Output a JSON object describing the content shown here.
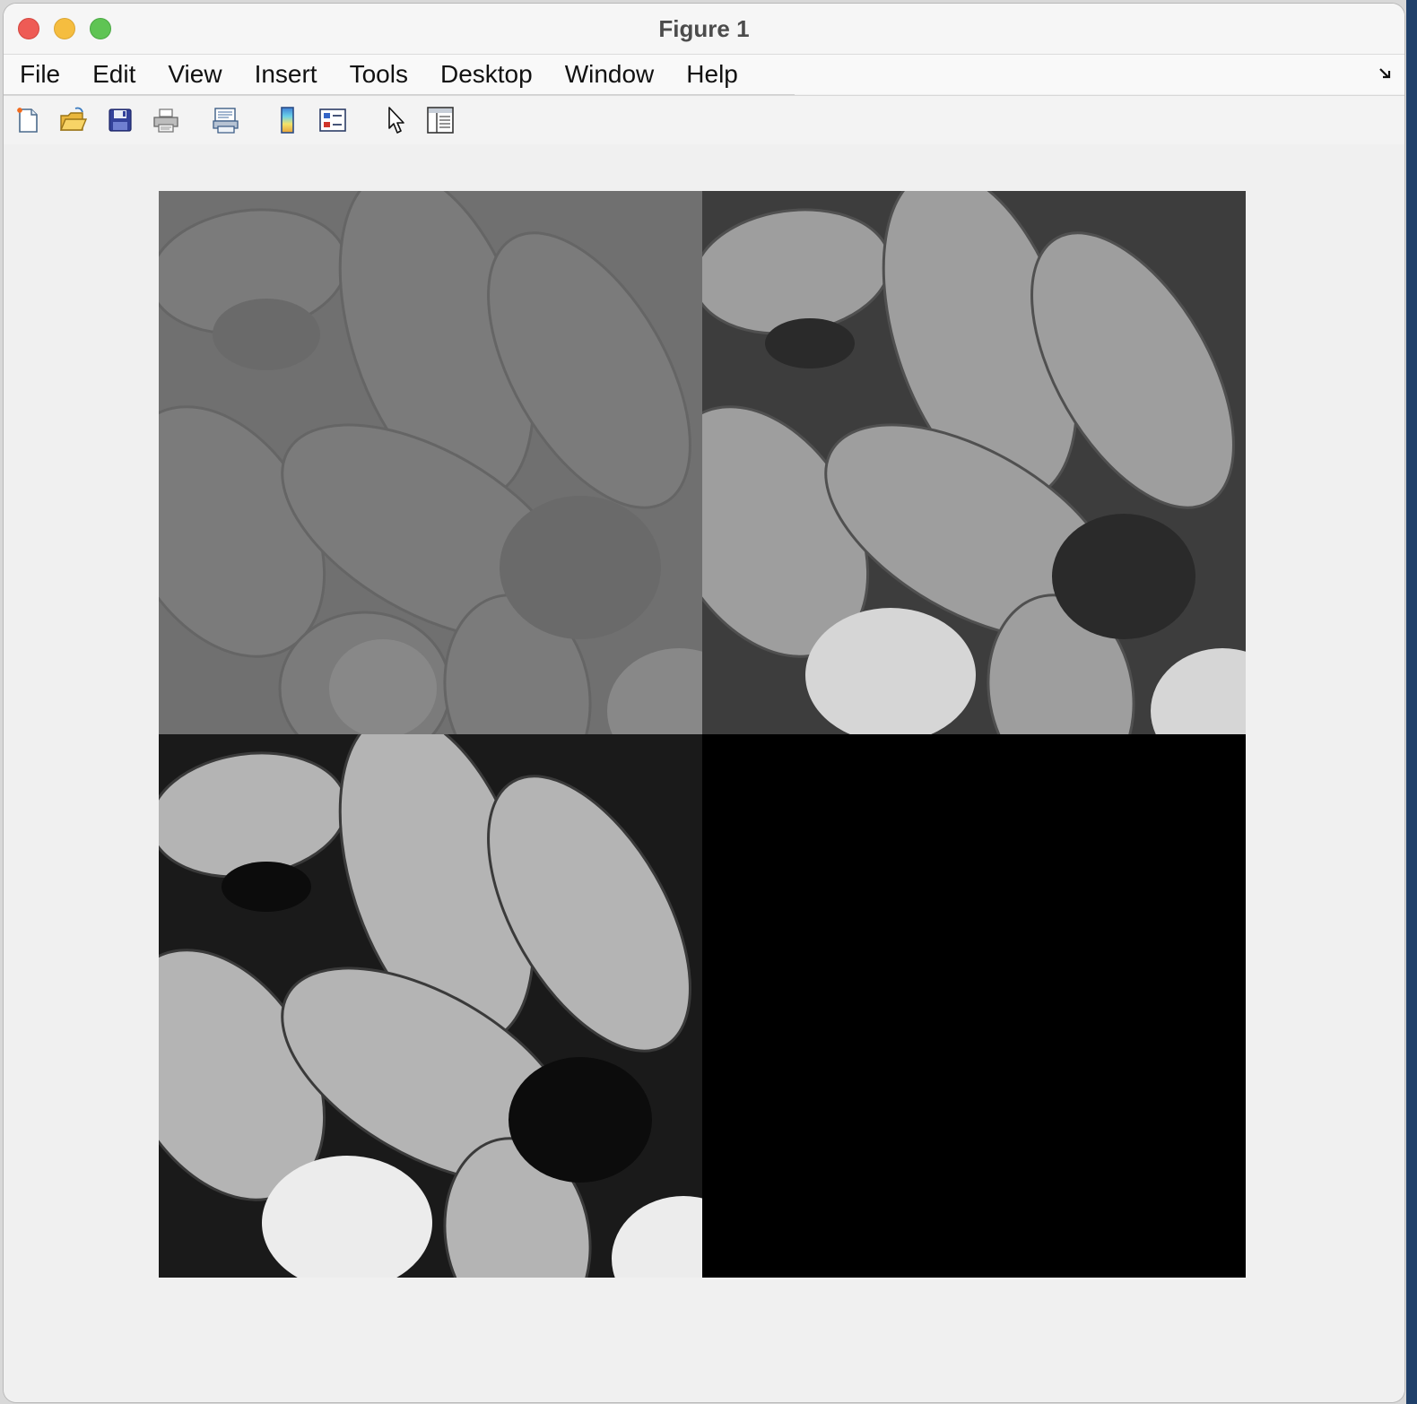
{
  "window": {
    "title": "Figure 1"
  },
  "menubar": {
    "items": [
      "File",
      "Edit",
      "View",
      "Insert",
      "Tools",
      "Desktop",
      "Window",
      "Help"
    ]
  },
  "toolbar": {
    "icons": [
      "new-figure-icon",
      "open-file-icon",
      "save-icon",
      "print-icon",
      "print-preview-icon",
      "colorbar-icon",
      "legend-icon",
      "edit-plot-icon",
      "property-inspector-icon"
    ]
  },
  "figure": {
    "panels": [
      {
        "name": "low-contrast-pollen-image",
        "tone": "low-contrast gray"
      },
      {
        "name": "stretched-pollen-image",
        "tone": "medium contrast"
      },
      {
        "name": "equalized-pollen-image",
        "tone": "high contrast"
      },
      {
        "name": "black-image",
        "tone": "black"
      }
    ]
  },
  "colors": {
    "close": "#ee5b55",
    "minimize": "#f5bd3f",
    "maximize": "#5fc454",
    "background": "#f0f0f0"
  }
}
